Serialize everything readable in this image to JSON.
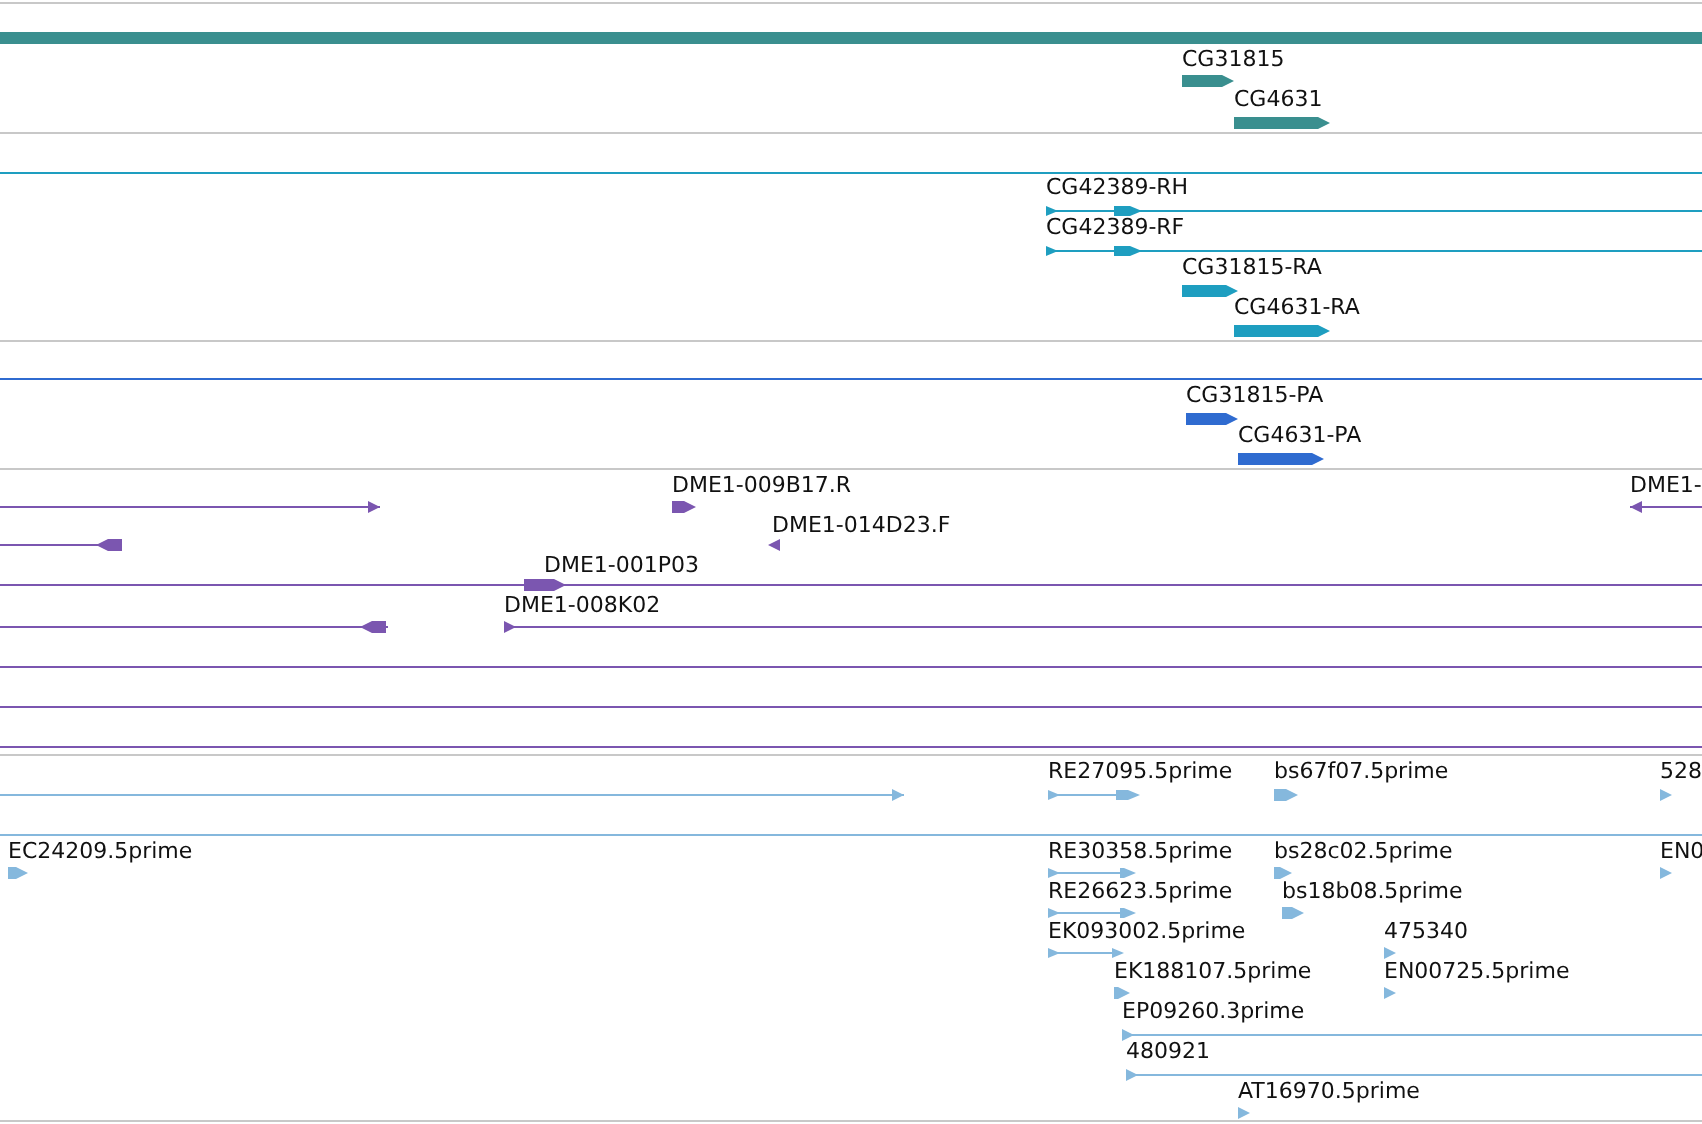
{
  "tracks": [
    {
      "color": "#3a8f8f",
      "features": [
        {
          "label": "CG31815"
        },
        {
          "label": "CG4631"
        }
      ]
    },
    {
      "color": "#1e9ec0",
      "features": [
        {
          "label": "CG42389-RH"
        },
        {
          "label": "CG42389-RF"
        },
        {
          "label": "CG31815-RA"
        },
        {
          "label": "CG4631-RA"
        }
      ]
    },
    {
      "color": "#2f6bd0",
      "features": [
        {
          "label": "CG31815-PA"
        },
        {
          "label": "CG4631-PA"
        }
      ]
    },
    {
      "color": "#7b56b0",
      "features": [
        {
          "label": "DME1-009B17.R"
        },
        {
          "label": "DME1-"
        },
        {
          "label": "DME1-014D23.F"
        },
        {
          "label": "DME1-001P03"
        },
        {
          "label": "DME1-008K02"
        }
      ]
    },
    {
      "color": "#85b8dd",
      "features": [
        {
          "label": "RE27095.5prime"
        },
        {
          "label": "bs67f07.5prime"
        },
        {
          "label": "528"
        },
        {
          "label": "EC24209.5prime"
        },
        {
          "label": "RE30358.5prime"
        },
        {
          "label": "bs28c02.5prime"
        },
        {
          "label": "EN0"
        },
        {
          "label": "RE26623.5prime"
        },
        {
          "label": "bs18b08.5prime"
        },
        {
          "label": "EK093002.5prime"
        },
        {
          "label": "475340"
        },
        {
          "label": "EK188107.5prime"
        },
        {
          "label": "EN00725.5prime"
        },
        {
          "label": "EP09260.3prime"
        },
        {
          "label": "480921"
        },
        {
          "label": "AT16970.5prime"
        }
      ]
    }
  ]
}
